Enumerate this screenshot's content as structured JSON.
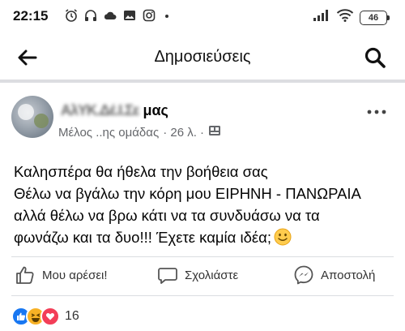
{
  "status_bar": {
    "time": "22:15",
    "battery": "46"
  },
  "header": {
    "title": "Δημοσιεύσεις"
  },
  "post": {
    "author_visible": "μας",
    "member_label": "Μέλος ..ης ομάδας",
    "time_ago": "· 26 λ. ·",
    "text_lines": [
      "Καλησπέρα θα ήθελα την βοήθεια σας",
      "Θέλω να βγάλω την κόρη μου ΕΙΡΗΝΗ - ΠΑΝΩΡΑΙΑ",
      "αλλά θέλω να βρω κάτι να τα συνδυάσω να τα",
      "φωνάζω και τα δυο!!! Έχετε καμία ιδέα;"
    ]
  },
  "actions": {
    "like": "Μου αρέσει!",
    "comment": "Σχολιάστε",
    "send": "Αποστολή"
  },
  "reactions": {
    "count": "16",
    "types": [
      "like-icon",
      "haha-icon",
      "love-icon"
    ]
  },
  "colors": {
    "brand_blue": "#1877f2",
    "love_red": "#f33e58",
    "haha_yellow": "#f7b125",
    "secondary_text": "#65676b"
  }
}
